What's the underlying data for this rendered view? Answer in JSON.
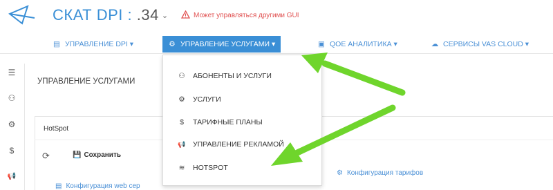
{
  "header": {
    "title": "СКАТ DPI : ",
    "version": ".34",
    "version_chevron": "⌄",
    "warning": "Может управляться другими GUI"
  },
  "nav": [
    {
      "label": "УПРАВЛЕНИЕ DPI",
      "icon": "list-icon",
      "glyph": "▤",
      "caret": "▾"
    },
    {
      "label": "УПРАВЛЕНИЕ УСЛУГАМИ",
      "icon": "cogs-icon",
      "glyph": "⚙",
      "caret": "▾",
      "active": true
    },
    {
      "label": "QOE АНАЛИТИКА",
      "icon": "chart-icon",
      "glyph": "▣",
      "caret": "▾"
    },
    {
      "label": "СЕРВИСЫ VAS CLOUD",
      "icon": "cloud-icon",
      "glyph": "☁",
      "caret": "▾"
    }
  ],
  "dropdown": [
    {
      "label": "АБОНЕНТЫ И УСЛУГИ",
      "icon": "users-icon",
      "glyph": "⚇"
    },
    {
      "label": "УСЛУГИ",
      "icon": "cogs-icon",
      "glyph": "⚙"
    },
    {
      "label": "ТАРИФНЫЕ ПЛАНЫ",
      "icon": "dollar-icon",
      "glyph": "$"
    },
    {
      "label": "УПРАВЛЕНИЕ РЕКЛАМОЙ",
      "icon": "megaphone-icon",
      "glyph": "📢"
    },
    {
      "label": "HOTSPOT",
      "icon": "wifi-icon",
      "glyph": "≋"
    }
  ],
  "sidebar": [
    {
      "icon": "menu-icon",
      "glyph": "☰"
    },
    {
      "icon": "users-icon",
      "glyph": "⚇"
    },
    {
      "icon": "cogs-icon",
      "glyph": "⚙"
    },
    {
      "icon": "dollar-icon",
      "glyph": "$"
    },
    {
      "icon": "megaphone-icon",
      "glyph": "📢"
    }
  ],
  "main": {
    "page_title": "УПРАВЛЕНИЕ УСЛУГАМИ",
    "panel_title": "HotSpot",
    "refresh_glyph": "⟳",
    "save_glyph": "💾",
    "save_label": "Сохранить",
    "config_web": "Конфигурация web сер",
    "config_web_glyph": "▤",
    "config_tariffs": "Конфигурация тарифов",
    "config_tariffs_glyph": "⚙"
  },
  "colors": {
    "accent": "#3a8fd6",
    "warning": "#e05050",
    "annotation_arrow": "#6fd52c"
  }
}
